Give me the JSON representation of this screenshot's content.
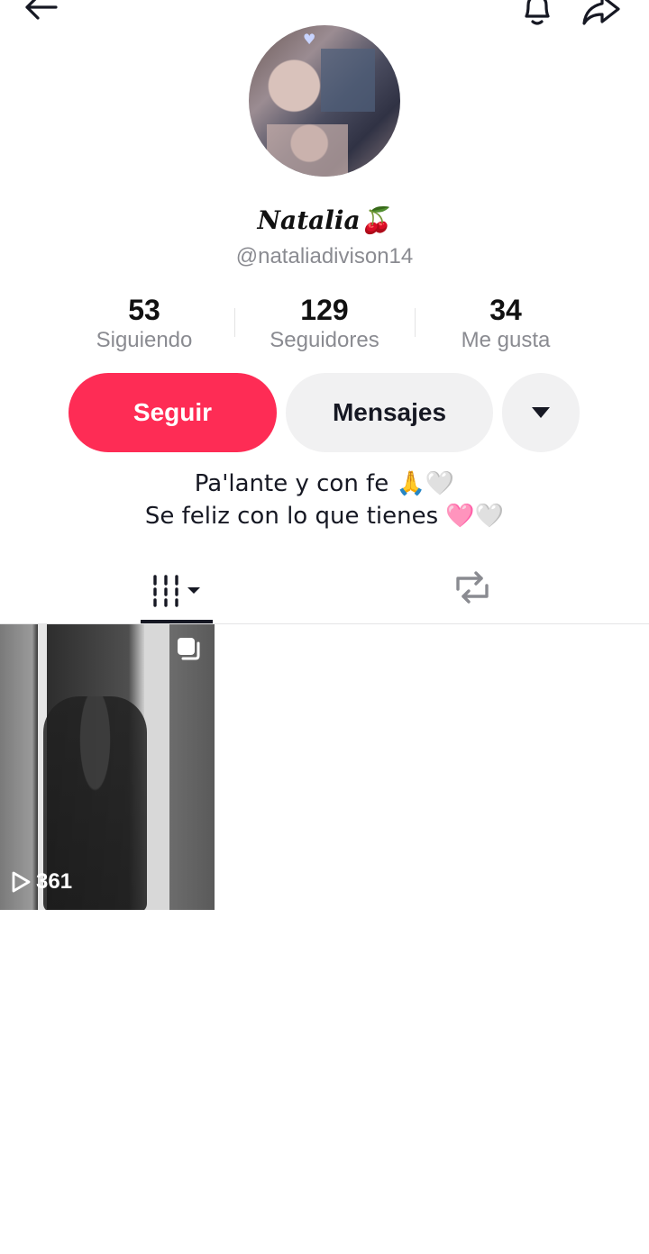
{
  "header": {
    "back_icon": "arrow-left-icon",
    "bell_icon": "bell-icon",
    "share_icon": "share-arrow-icon"
  },
  "profile": {
    "display_name": "𝑵𝒂𝒕𝒂𝒍𝒊𝒂🍒",
    "username": "@nataliadivison14"
  },
  "stats": [
    {
      "value": "53",
      "label": "Siguiendo"
    },
    {
      "value": "129",
      "label": "Seguidores"
    },
    {
      "value": "34",
      "label": "Me gusta"
    }
  ],
  "actions": {
    "follow_label": "Seguir",
    "message_label": "Mensajes",
    "more_icon": "caret-down-icon"
  },
  "bio": {
    "line1": "Pa'lante y con fe 🙏🤍",
    "line2": "Se feliz con lo que tienes 🩷🤍"
  },
  "tabs": {
    "videos_icon": "grid-bars-icon",
    "reposts_icon": "repost-icon"
  },
  "videos": [
    {
      "play_count": "361",
      "multi_icon": "multi-image-icon",
      "play_icon": "play-outline-icon"
    }
  ],
  "colors": {
    "accent": "#fe2c55",
    "button_gray": "#f1f1f2",
    "secondary_text": "#8a8b91"
  }
}
